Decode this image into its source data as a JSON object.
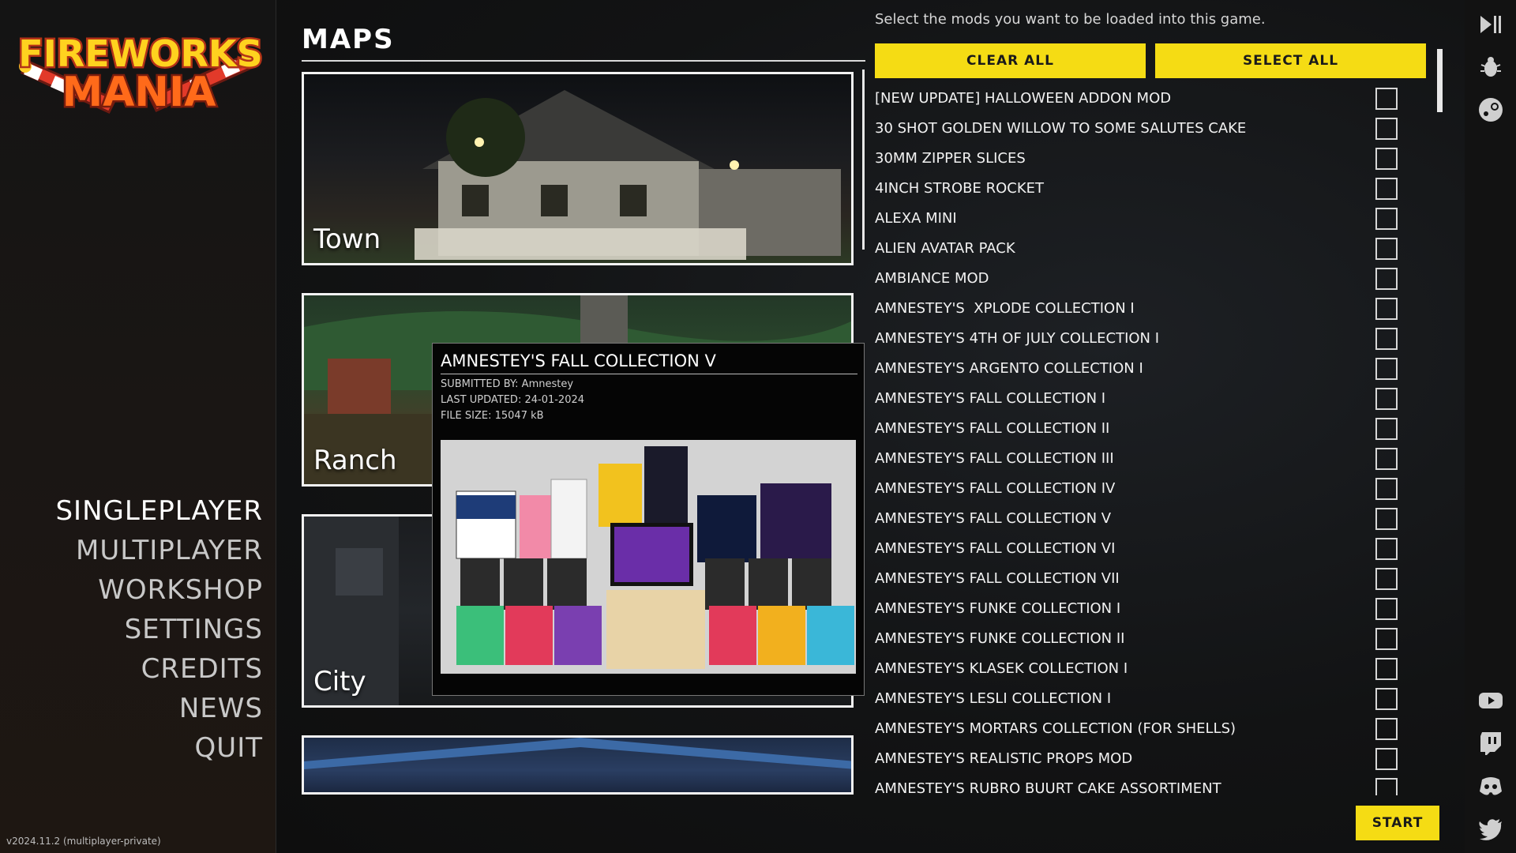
{
  "logo": {
    "line1": "FIREWORKS",
    "line2": "MANIA"
  },
  "nav": [
    {
      "label": "SINGLEPLAYER"
    },
    {
      "label": "MULTIPLAYER"
    },
    {
      "label": "WORKSHOP"
    },
    {
      "label": "SETTINGS"
    },
    {
      "label": "CREDITS"
    },
    {
      "label": "NEWS"
    },
    {
      "label": "QUIT"
    }
  ],
  "version": "v2024.11.2 (multiplayer-private)",
  "maps": {
    "title": "MAPS",
    "items": [
      {
        "label": "Town"
      },
      {
        "label": "Ranch"
      },
      {
        "label": "City"
      },
      {
        "label": ""
      }
    ]
  },
  "tooltip": {
    "title": "AMNESTEY'S FALL COLLECTION V",
    "submitted": "SUBMITTED BY: Amnestey",
    "updated": "LAST UPDATED: 24-01-2024",
    "size": "FILE SIZE: 15047 kB"
  },
  "mods": {
    "instruction": "Select the mods you want to be loaded into this game.",
    "clear_all": "CLEAR ALL",
    "select_all": "SELECT ALL",
    "items": [
      {
        "name": "[NEW UPDATE] HALLOWEEN ADDON MOD"
      },
      {
        "name": "30 SHOT GOLDEN WILLOW TO SOME SALUTES CAKE"
      },
      {
        "name": "30MM ZIPPER SLICES"
      },
      {
        "name": "4INCH STROBE ROCKET"
      },
      {
        "name": "ALEXA MINI"
      },
      {
        "name": "ALIEN AVATAR PACK"
      },
      {
        "name": "AMBIANCE MOD"
      },
      {
        "name": "AMNESTEY'S  XPLODE COLLECTION I"
      },
      {
        "name": "AMNESTEY'S 4TH OF JULY COLLECTION I"
      },
      {
        "name": "AMNESTEY'S ARGENTO COLLECTION I"
      },
      {
        "name": "AMNESTEY'S FALL COLLECTION I"
      },
      {
        "name": "AMNESTEY'S FALL COLLECTION II"
      },
      {
        "name": "AMNESTEY'S FALL COLLECTION III"
      },
      {
        "name": "AMNESTEY'S FALL COLLECTION IV"
      },
      {
        "name": "AMNESTEY'S FALL COLLECTION V"
      },
      {
        "name": "AMNESTEY'S FALL COLLECTION VI"
      },
      {
        "name": "AMNESTEY'S FALL COLLECTION VII"
      },
      {
        "name": "AMNESTEY'S FUNKE COLLECTION I"
      },
      {
        "name": "AMNESTEY'S FUNKE COLLECTION II"
      },
      {
        "name": "AMNESTEY'S KLASEK COLLECTION I"
      },
      {
        "name": "AMNESTEY'S LESLI COLLECTION I"
      },
      {
        "name": "AMNESTEY'S MORTARS COLLECTION (FOR SHELLS)"
      },
      {
        "name": "AMNESTEY'S REALISTIC PROPS MOD"
      },
      {
        "name": "AMNESTEY'S RUBRO BUURT CAKE ASSORTIMENT"
      }
    ],
    "start": "START"
  },
  "colors": {
    "accent": "#f5dc14",
    "background": "#121212"
  }
}
